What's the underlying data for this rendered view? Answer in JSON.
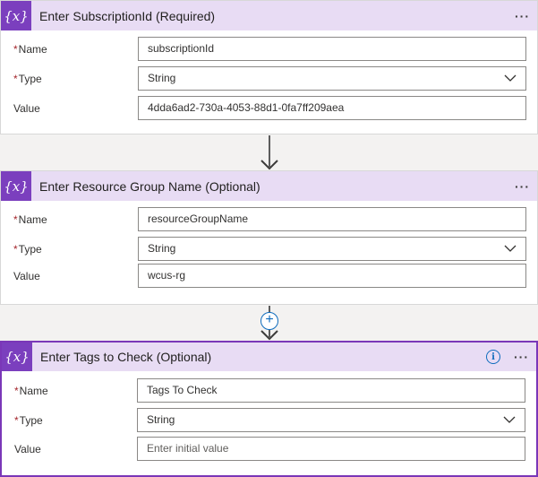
{
  "cards": [
    {
      "icon": "{x}",
      "title": "Enter SubscriptionId (Required)",
      "more": "···",
      "name_label": "Name",
      "name_value": "subscriptionId",
      "type_label": "Type",
      "type_value": "String",
      "value_label": "Value",
      "value_value": "4dda6ad2-730a-4053-88d1-0fa7ff209aea"
    },
    {
      "icon": "{x}",
      "title": "Enter Resource Group Name (Optional)",
      "more": "···",
      "name_label": "Name",
      "name_value": "resourceGroupName",
      "type_label": "Type",
      "type_value": "String",
      "value_label": "Value",
      "value_value": "wcus-rg"
    },
    {
      "icon": "{x}",
      "title": "Enter Tags to Check (Optional)",
      "more": "···",
      "info": "i",
      "name_label": "Name",
      "name_value": "Tags To Check",
      "type_label": "Type",
      "type_value": "String",
      "value_label": "Value",
      "value_placeholder": "Enter initial value"
    }
  ],
  "required_marker": "*",
  "insert_step": "+",
  "colors": {
    "accent": "#7b3fbe",
    "header_bg": "#e8dcf4",
    "selected_border": "#7a37b8",
    "link_blue": "#0f6cbd",
    "required": "#a4262c"
  }
}
